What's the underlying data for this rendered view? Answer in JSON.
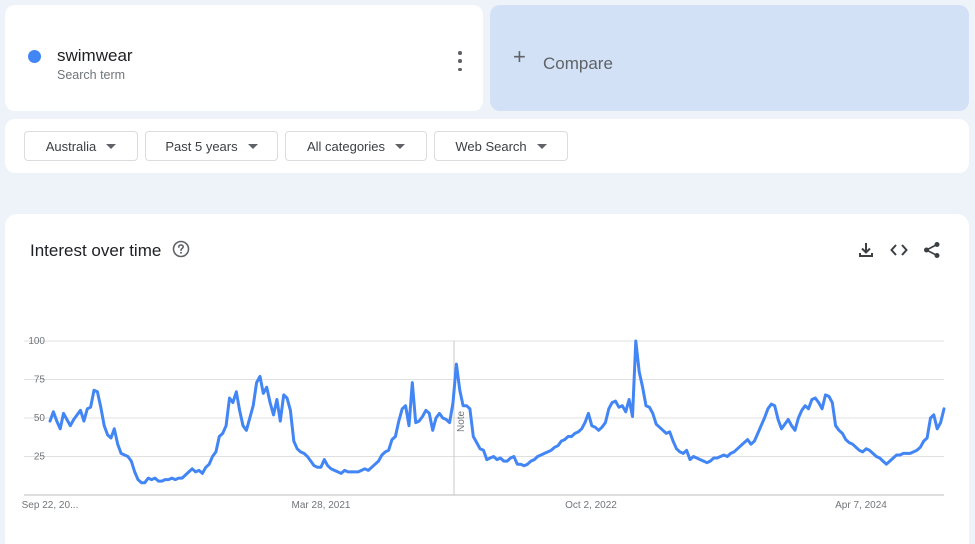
{
  "search_term": {
    "name": "swimwear",
    "subtitle": "Search term",
    "color": "#4285f4"
  },
  "compare": {
    "label": "Compare",
    "icon": "plus-icon"
  },
  "filters": {
    "region": "Australia",
    "time_range": "Past 5 years",
    "category": "All categories",
    "search_type": "Web Search"
  },
  "section": {
    "title": "Interest over time",
    "help_icon": "help-circle-icon",
    "tools": [
      "download-icon",
      "embed-code-icon",
      "share-icon"
    ]
  },
  "chart_data": {
    "type": "line",
    "title": "Interest over time",
    "ylim": [
      0,
      100
    ],
    "y_ticks": [
      "100",
      "75",
      "50",
      "25"
    ],
    "x_tick_labels": [
      "Sep 22, 20...",
      "Mar 28, 2021",
      "Oct 2, 2022",
      "Apr 7, 2024"
    ],
    "note_label": "Note",
    "grid": true,
    "series": [
      {
        "name": "swimwear",
        "color": "#4285f4",
        "values": [
          48,
          54,
          48,
          43,
          53,
          49,
          45,
          49,
          52,
          55,
          48,
          56,
          57,
          68,
          67,
          57,
          45,
          39,
          37,
          43,
          33,
          27,
          26,
          25,
          22,
          15,
          10,
          8,
          8,
          11,
          10,
          11,
          9,
          9,
          10,
          10,
          11,
          10,
          11,
          11,
          13,
          15,
          17,
          15,
          16,
          14,
          18,
          20,
          25,
          28,
          38,
          40,
          45,
          63,
          60,
          67,
          55,
          45,
          42,
          50,
          58,
          73,
          77,
          66,
          70,
          60,
          52,
          62,
          48,
          65,
          63,
          55,
          35,
          30,
          28,
          27,
          25,
          22,
          19,
          18,
          18,
          23,
          19,
          17,
          16,
          15,
          14,
          16,
          15,
          15,
          15,
          15,
          16,
          17,
          16,
          18,
          20,
          22,
          26,
          28,
          29,
          36,
          38,
          48,
          56,
          58,
          45,
          73,
          47,
          48,
          51,
          55,
          53,
          42,
          50,
          53,
          50,
          49,
          47,
          60,
          85,
          68,
          58,
          58,
          56,
          38,
          34,
          30,
          29,
          23,
          24,
          25,
          23,
          24,
          22,
          22,
          24,
          25,
          20,
          20,
          19,
          20,
          22,
          23,
          25,
          26,
          27,
          28,
          29,
          31,
          32,
          35,
          36,
          38,
          38,
          40,
          41,
          43,
          47,
          53,
          45,
          44,
          42,
          44,
          47,
          56,
          60,
          61,
          57,
          58,
          54,
          62,
          51,
          100,
          80,
          70,
          58,
          57,
          53,
          46,
          44,
          42,
          40,
          41,
          35,
          30,
          28,
          27,
          29,
          23,
          25,
          24,
          23,
          22,
          21,
          22,
          24,
          24,
          25,
          26,
          25,
          27,
          28,
          30,
          32,
          34,
          36,
          33,
          35,
          40,
          45,
          50,
          56,
          59,
          58,
          49,
          43,
          46,
          49,
          45,
          42,
          50,
          55,
          58,
          56,
          62,
          63,
          60,
          56,
          65,
          64,
          60,
          45,
          42,
          40,
          36,
          34,
          33,
          31,
          29,
          28,
          30,
          29,
          27,
          25,
          24,
          22,
          20,
          22,
          24,
          26,
          26,
          27,
          27,
          27,
          28,
          29,
          31,
          35,
          37,
          50,
          52,
          43,
          47,
          56
        ]
      }
    ]
  }
}
